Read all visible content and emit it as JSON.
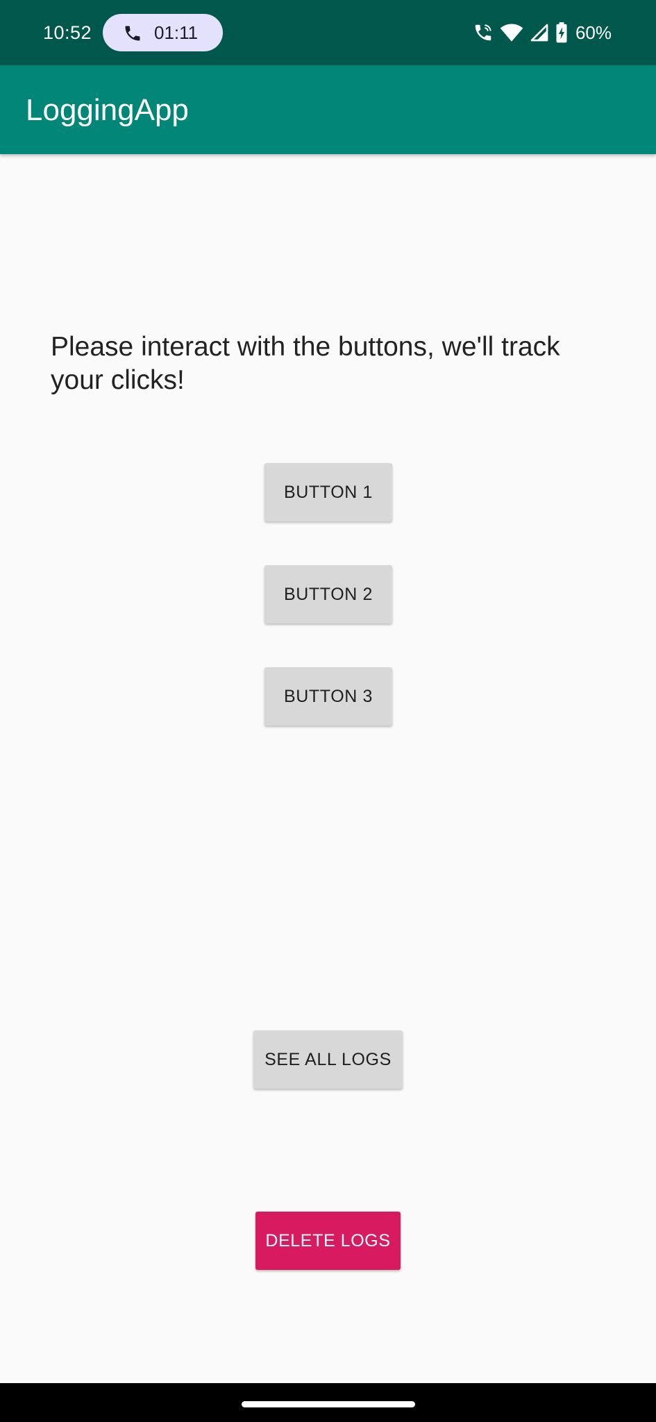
{
  "status_bar": {
    "time": "10:52",
    "call_duration": "01:11",
    "battery": "60%",
    "icons": [
      "phone-icon",
      "wifi-call-icon",
      "wifi-icon",
      "signal-icon",
      "battery-charging-icon"
    ]
  },
  "app_bar": {
    "title": "LoggingApp"
  },
  "main": {
    "instructions": "Please interact with the buttons, we'll track your clicks!",
    "button1": "BUTTON 1",
    "button2": "BUTTON 2",
    "button3": "BUTTON 3",
    "see_all_logs": "SEE ALL LOGS",
    "delete_logs": "DELETE LOGS"
  },
  "colors": {
    "status_bar": "#00584c",
    "app_bar": "#028678",
    "background": "#fafafa",
    "button": "#d8d8d8",
    "delete_button": "#d81b60",
    "call_pill": "#e3e1fb"
  }
}
